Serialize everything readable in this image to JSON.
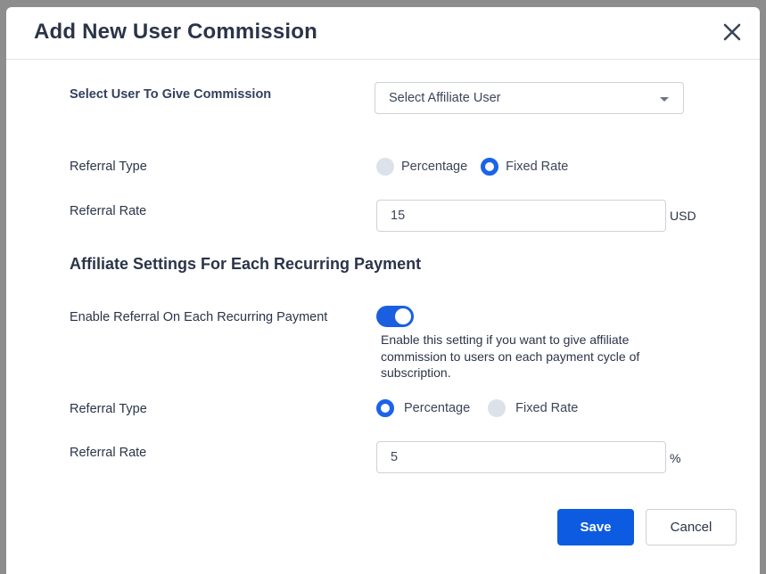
{
  "modal": {
    "title": "Add New User Commission",
    "close_icon": "close-icon"
  },
  "user_select": {
    "label": "Select User To Give Commission",
    "value": "Select Affiliate User",
    "icon": "chevron-down-icon"
  },
  "referral": {
    "type_label": "Referral Type",
    "options": [
      "Percentage",
      "Fixed Rate"
    ],
    "selected": "Fixed Rate",
    "rate_label": "Referral Rate",
    "rate_value": "15",
    "rate_unit": "USD"
  },
  "recurring": {
    "section_title": "Affiliate Settings For Each Recurring Payment",
    "toggle_label": "Enable Referral On Each Recurring Payment",
    "toggle_on": true,
    "help_text": "Enable this setting if you want to give affiliate commission to users on each payment cycle of subscription.",
    "type_label": "Referral Type",
    "options": [
      "Percentage",
      "Fixed Rate"
    ],
    "selected": "Percentage",
    "rate_label": "Referral Rate",
    "rate_value": "5",
    "rate_unit": "%"
  },
  "footer": {
    "save_label": "Save",
    "cancel_label": "Cancel"
  },
  "colors": {
    "primary": "#0d5be1",
    "radio_on": "#1b63e8",
    "radio_off": "#dde1ea"
  }
}
